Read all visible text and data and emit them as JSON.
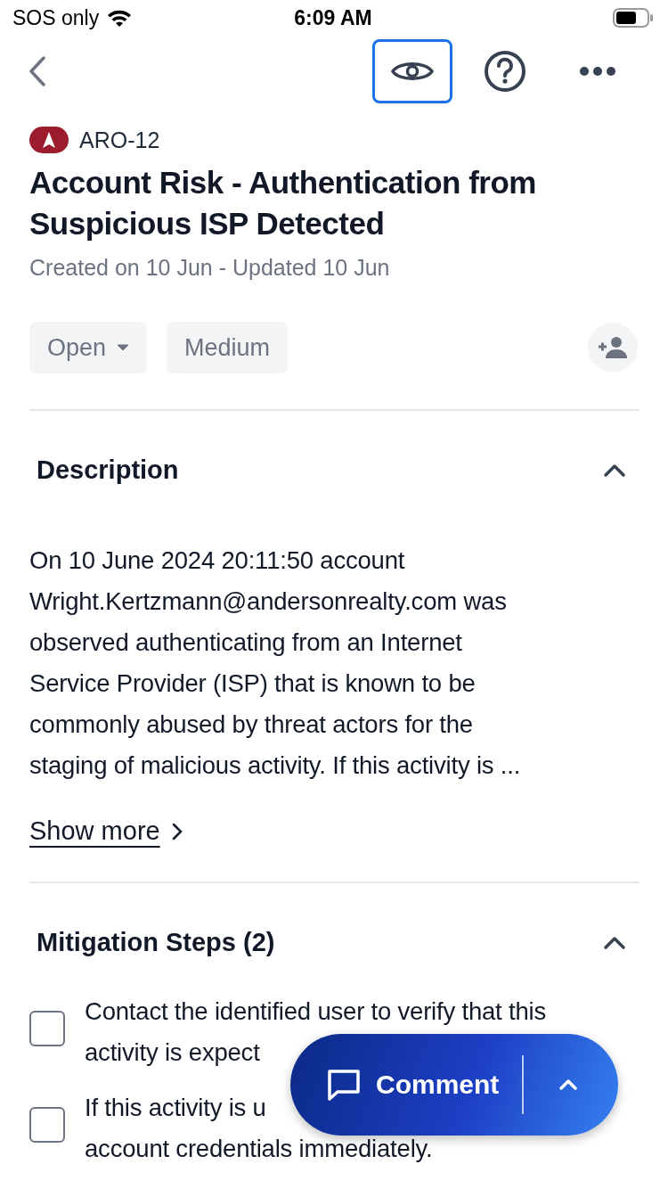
{
  "status_bar": {
    "carrier": "SOS only",
    "time": "6:09 AM"
  },
  "nav": {
    "actions": [
      {
        "kind": "eye",
        "focused": true
      },
      {
        "kind": "help",
        "focused": false
      },
      {
        "kind": "more",
        "focused": false
      }
    ]
  },
  "issue": {
    "key": "ARO-12",
    "title": "Account Risk - Authentication from Suspicious ISP Detected",
    "meta": "Created on 10 Jun - Updated 10 Jun"
  },
  "chips": [
    {
      "label": "Open",
      "kind": "dropdown"
    },
    {
      "label": "Medium",
      "kind": "plain"
    }
  ],
  "description": {
    "heading": "Description",
    "expanded": true,
    "lines": [
      "On 10 June 2024 20:11:50 account",
      "Wright.Kertzmann@andersonrealty.com was",
      "observed authenticating from an Internet",
      "Service Provider (ISP) that is known to be",
      "commonly abused by threat actors for the",
      "staging of malicious activity. If this activity is ..."
    ],
    "show_more": "Show more"
  },
  "mitigation": {
    "heading": "Mitigation Steps (2)",
    "expanded": true,
    "steps": [
      {
        "checked": false,
        "lines": [
          "Contact the identified user to verify that this",
          "activity is expect"
        ]
      },
      {
        "checked": false,
        "lines": [
          "If this activity is u",
          "account credentials immediately."
        ]
      }
    ]
  },
  "comment_button": {
    "label": "Comment"
  }
}
